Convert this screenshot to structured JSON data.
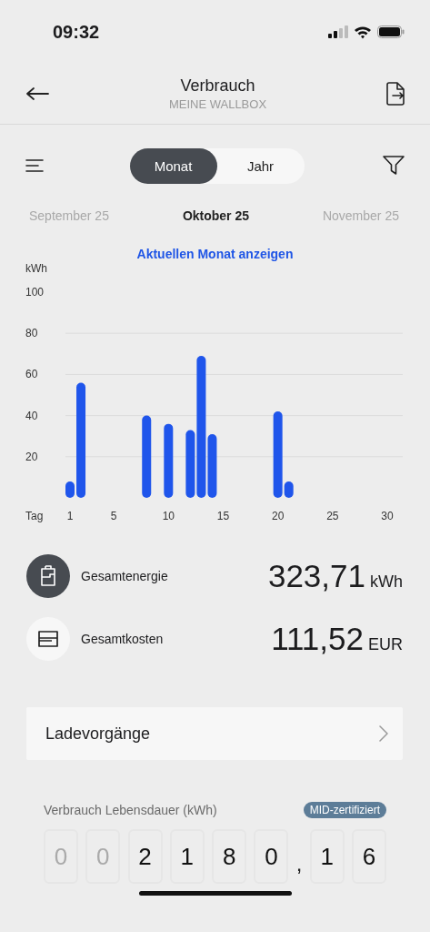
{
  "status_bar": {
    "time": "09:32"
  },
  "header": {
    "title": "Verbrauch",
    "subtitle": "MEINE WALLBOX"
  },
  "period_tabs": [
    {
      "label": "Monat",
      "selected": true
    },
    {
      "label": "Jahr",
      "selected": false
    }
  ],
  "months": [
    {
      "label": "September 25",
      "selected": false
    },
    {
      "label": "Oktober 25",
      "selected": true
    },
    {
      "label": "November 25",
      "selected": false
    }
  ],
  "current_month_link": "Aktuellen Monat anzeigen",
  "chart": {
    "chart_data": {
      "type": "bar",
      "xlabel": "Tag",
      "ylabel": "kWh",
      "x": [
        1,
        2,
        8,
        10,
        12,
        13,
        14,
        20,
        21
      ],
      "values": [
        8,
        56,
        40,
        36,
        33,
        69,
        31,
        42,
        8
      ],
      "xlim": [
        1,
        30
      ],
      "ylim": [
        0,
        100
      ],
      "grid": true,
      "xticks": [
        1,
        5,
        10,
        15,
        20,
        25,
        30
      ],
      "yticks": [
        20,
        40,
        60,
        80,
        100
      ]
    }
  },
  "totals": [
    {
      "kind": "energy",
      "label": "Gesamtenergie",
      "value": "323,71",
      "unit": "kWh"
    },
    {
      "kind": "cost",
      "label": "Gesamtkosten",
      "value": "111,52",
      "unit": "EUR"
    }
  ],
  "sessions_link": {
    "label": "Ladevorgänge"
  },
  "lifetime": {
    "label": "Verbrauch Lebensdauer (kWh)",
    "badge": "MID-zertifiziert",
    "digits": [
      {
        "kind": "digit",
        "text": "0",
        "dimmed": true
      },
      {
        "kind": "digit",
        "text": "0",
        "dimmed": true
      },
      {
        "kind": "digit",
        "text": "2",
        "dimmed": false
      },
      {
        "kind": "digit",
        "text": "1",
        "dimmed": false
      },
      {
        "kind": "digit",
        "text": "8",
        "dimmed": false
      },
      {
        "kind": "digit",
        "text": "0",
        "dimmed": false
      },
      {
        "kind": "separator",
        "text": ","
      },
      {
        "kind": "digit",
        "text": "1",
        "dimmed": false
      },
      {
        "kind": "digit",
        "text": "6",
        "dimmed": false
      }
    ]
  }
}
